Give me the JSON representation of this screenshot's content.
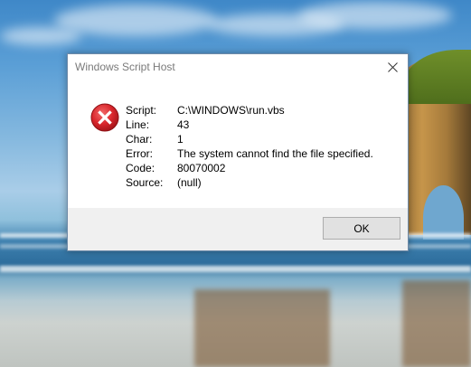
{
  "dialog": {
    "title": "Windows Script Host",
    "close_icon": "close-icon",
    "error_icon": "error-icon",
    "fields": [
      {
        "label": "Script:",
        "value": "C:\\WINDOWS\\run.vbs"
      },
      {
        "label": "Line:",
        "value": "43"
      },
      {
        "label": "Char:",
        "value": "1"
      },
      {
        "label": "Error:",
        "value": "The system cannot find the file specified."
      },
      {
        "label": "Code:",
        "value": "80070002"
      },
      {
        "label": "Source:",
        "value": "(null)"
      }
    ],
    "ok_label": "OK"
  },
  "colors": {
    "error_red": "#d9262c",
    "footer_bg": "#f0f0f0",
    "button_bg": "#e1e1e1",
    "button_border": "#adadad"
  }
}
